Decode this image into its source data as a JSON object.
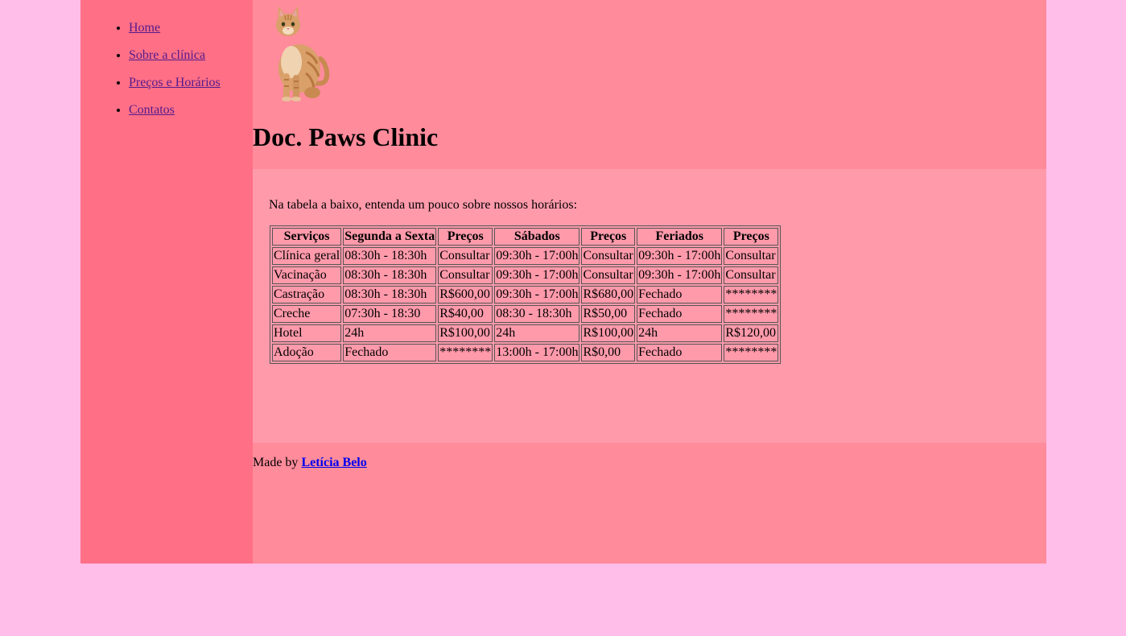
{
  "nav": {
    "items": [
      {
        "label": "Home"
      },
      {
        "label": "Sobre a clínica"
      },
      {
        "label": "Preços e Horários"
      },
      {
        "label": "Contatos"
      }
    ]
  },
  "header": {
    "logo_icon": "cat-photo",
    "title": "Doc. Paws Clinic"
  },
  "main": {
    "intro": "Na tabela a baixo, entenda um pouco sobre nossos horários:",
    "table": {
      "headers": [
        "Serviços",
        "Segunda a Sexta",
        "Preços",
        "Sábados",
        "Preços",
        "Feriados",
        "Preços"
      ],
      "rows": [
        [
          "Clínica geral",
          "08:30h - 18:30h",
          "Consultar",
          "09:30h - 17:00h",
          "Consultar",
          "09:30h - 17:00h",
          "Consultar"
        ],
        [
          "Vacinação",
          "08:30h - 18:30h",
          "Consultar",
          "09:30h - 17:00h",
          "Consultar",
          "09:30h - 17:00h",
          "Consultar"
        ],
        [
          "Castração",
          "08:30h - 18:30h",
          "R$600,00",
          "09:30h - 17:00h",
          "R$680,00",
          "Fechado",
          "********"
        ],
        [
          "Creche",
          "07:30h - 18:30",
          "R$40,00",
          "08:30 - 18:30h",
          "R$50,00",
          "Fechado",
          "********"
        ],
        [
          "Hotel",
          "24h",
          "R$100,00",
          "24h",
          "R$100,00",
          "24h",
          "R$120,00"
        ],
        [
          "Adoção",
          "Fechado",
          "********",
          "13:00h - 17:00h",
          "R$0,00",
          "Fechado",
          "********"
        ]
      ]
    }
  },
  "footer": {
    "prefix": "Made by",
    "author": "Letícia Belo"
  },
  "colors": {
    "page_bg": "#ffbde9",
    "wrapper_bg": "#ff8b9b",
    "sidebar_bg": "#ff6f86",
    "content_bg": "#ff9aab",
    "visited_link": "#551a8b",
    "link": "#0000ee"
  }
}
